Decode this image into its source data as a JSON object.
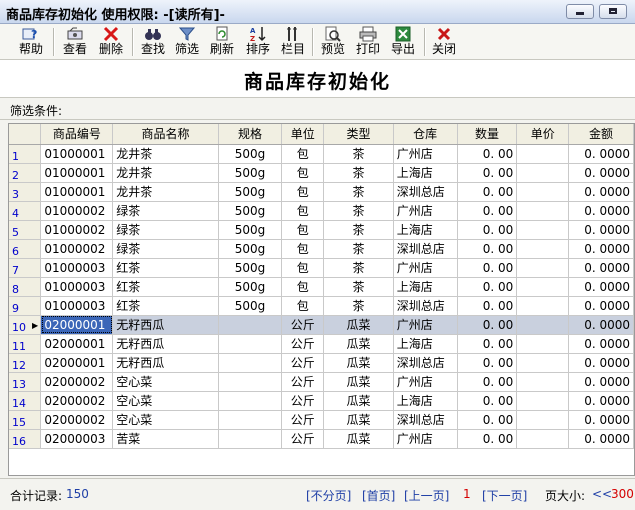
{
  "window": {
    "title": "商品库存初始化  使用权限: -[读所有]-"
  },
  "toolbar": [
    {
      "label": "帮助",
      "icon": "help-icon"
    },
    {
      "label": "查看",
      "icon": "view-icon"
    },
    {
      "label": "删除",
      "icon": "delete-icon"
    },
    {
      "label": "查找",
      "icon": "find-icon"
    },
    {
      "label": "筛选",
      "icon": "filter-icon"
    },
    {
      "label": "刷新",
      "icon": "refresh-icon"
    },
    {
      "label": "排序",
      "icon": "sort-icon"
    },
    {
      "label": "栏目",
      "icon": "columns-icon"
    },
    {
      "label": "预览",
      "icon": "preview-icon"
    },
    {
      "label": "打印",
      "icon": "print-icon"
    },
    {
      "label": "导出",
      "icon": "export-icon"
    },
    {
      "label": "关闭",
      "icon": "close-icon"
    }
  ],
  "heading": "商品库存初始化",
  "filter_label": "筛选条件:",
  "columns": [
    "商品编号",
    "商品名称",
    "规格",
    "单位",
    "类型",
    "仓库",
    "数量",
    "单价",
    "金额"
  ],
  "rows": [
    {
      "n": "1",
      "code": "01000001",
      "name": "龙井茶",
      "spec": "500g",
      "unit": "包",
      "type": "茶",
      "store": "广州店",
      "qty": "0. 00",
      "price": "",
      "amount": "0. 0000"
    },
    {
      "n": "2",
      "code": "01000001",
      "name": "龙井茶",
      "spec": "500g",
      "unit": "包",
      "type": "茶",
      "store": "上海店",
      "qty": "0. 00",
      "price": "",
      "amount": "0. 0000"
    },
    {
      "n": "3",
      "code": "01000001",
      "name": "龙井茶",
      "spec": "500g",
      "unit": "包",
      "type": "茶",
      "store": "深圳总店",
      "qty": "0. 00",
      "price": "",
      "amount": "0. 0000"
    },
    {
      "n": "4",
      "code": "01000002",
      "name": "绿茶",
      "spec": "500g",
      "unit": "包",
      "type": "茶",
      "store": "广州店",
      "qty": "0. 00",
      "price": "",
      "amount": "0. 0000"
    },
    {
      "n": "5",
      "code": "01000002",
      "name": "绿茶",
      "spec": "500g",
      "unit": "包",
      "type": "茶",
      "store": "上海店",
      "qty": "0. 00",
      "price": "",
      "amount": "0. 0000"
    },
    {
      "n": "6",
      "code": "01000002",
      "name": "绿茶",
      "spec": "500g",
      "unit": "包",
      "type": "茶",
      "store": "深圳总店",
      "qty": "0. 00",
      "price": "",
      "amount": "0. 0000"
    },
    {
      "n": "7",
      "code": "01000003",
      "name": "红茶",
      "spec": "500g",
      "unit": "包",
      "type": "茶",
      "store": "广州店",
      "qty": "0. 00",
      "price": "",
      "amount": "0. 0000"
    },
    {
      "n": "8",
      "code": "01000003",
      "name": "红茶",
      "spec": "500g",
      "unit": "包",
      "type": "茶",
      "store": "上海店",
      "qty": "0. 00",
      "price": "",
      "amount": "0. 0000"
    },
    {
      "n": "9",
      "code": "01000003",
      "name": "红茶",
      "spec": "500g",
      "unit": "包",
      "type": "茶",
      "store": "深圳总店",
      "qty": "0. 00",
      "price": "",
      "amount": "0. 0000"
    },
    {
      "n": "10",
      "code": "02000001",
      "name": "无籽西瓜",
      "spec": "",
      "unit": "公斤",
      "type": "瓜菜",
      "store": "广州店",
      "qty": "0. 00",
      "price": "",
      "amount": "0. 0000"
    },
    {
      "n": "11",
      "code": "02000001",
      "name": "无籽西瓜",
      "spec": "",
      "unit": "公斤",
      "type": "瓜菜",
      "store": "上海店",
      "qty": "0. 00",
      "price": "",
      "amount": "0. 0000"
    },
    {
      "n": "12",
      "code": "02000001",
      "name": "无籽西瓜",
      "spec": "",
      "unit": "公斤",
      "type": "瓜菜",
      "store": "深圳总店",
      "qty": "0. 00",
      "price": "",
      "amount": "0. 0000"
    },
    {
      "n": "13",
      "code": "02000002",
      "name": "空心菜",
      "spec": "",
      "unit": "公斤",
      "type": "瓜菜",
      "store": "广州店",
      "qty": "0. 00",
      "price": "",
      "amount": "0. 0000"
    },
    {
      "n": "14",
      "code": "02000002",
      "name": "空心菜",
      "spec": "",
      "unit": "公斤",
      "type": "瓜菜",
      "store": "上海店",
      "qty": "0. 00",
      "price": "",
      "amount": "0. 0000"
    },
    {
      "n": "15",
      "code": "02000002",
      "name": "空心菜",
      "spec": "",
      "unit": "公斤",
      "type": "瓜菜",
      "store": "深圳总店",
      "qty": "0. 00",
      "price": "",
      "amount": "0. 0000"
    },
    {
      "n": "16",
      "code": "02000003",
      "name": "苦菜",
      "spec": "",
      "unit": "公斤",
      "type": "瓜菜",
      "store": "广州店",
      "qty": "0. 00",
      "price": "",
      "amount": "0. 0000"
    }
  ],
  "selected_row": "10",
  "status": {
    "total_label": "合计记录:",
    "total": "150",
    "no_paging": "[不分页]",
    "first": "[首页]",
    "prev": "[上一页]",
    "page": "1",
    "next": "[下一页]",
    "page_size_label": "页大小:",
    "page_size_prev": "<<",
    "page_size": "300"
  },
  "colors": {
    "accent": "#1f3fa6",
    "selected_row": "#c9d0de",
    "focus_cell": "#3b66b8",
    "red": "#d40000"
  }
}
